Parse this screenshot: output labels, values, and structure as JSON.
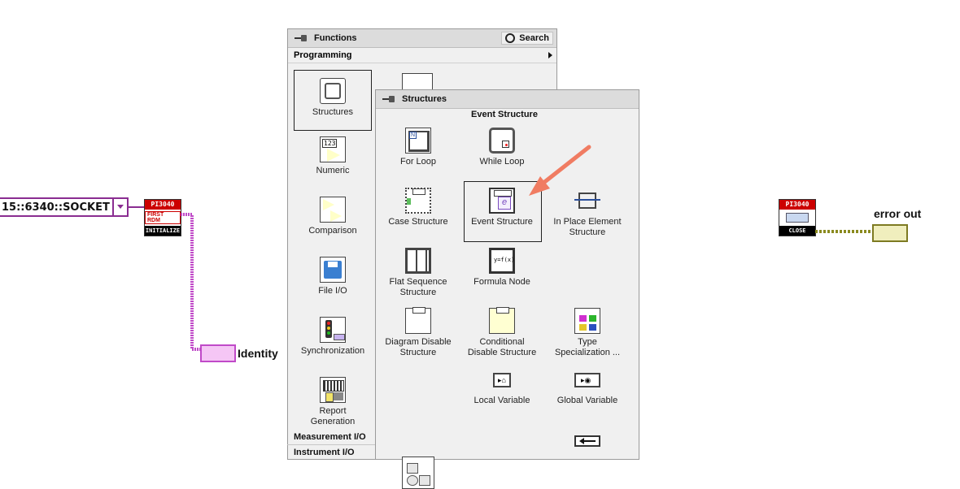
{
  "diagram": {
    "resource_text": "15::6340::SOCKET",
    "initialize_vi": {
      "header": "PI3040",
      "footer": "INITIALIZE",
      "badge": "FIRST RDM"
    },
    "close_vi": {
      "header": "PI3040",
      "footer": "CLOSE"
    },
    "identity_label": "Identity",
    "error_out_label": "error out"
  },
  "functions_palette": {
    "title": "Functions",
    "search_label": "Search",
    "category": "Programming",
    "items": [
      {
        "label": "Structures",
        "icon": "structures-icon"
      },
      {
        "label": "Numeric",
        "icon": "numeric-icon"
      },
      {
        "label": "Comparison",
        "icon": "comparison-icon"
      },
      {
        "label": "File I/O",
        "icon": "file-io-icon"
      },
      {
        "label": "Synchronization",
        "icon": "synchronization-icon"
      },
      {
        "label": "Report Generation",
        "icon": "report-generation-icon"
      }
    ],
    "sections": [
      "Measurement I/O",
      "Instrument I/O"
    ]
  },
  "structures_palette": {
    "title": "Structures",
    "hover_title": "Event Structure",
    "items": [
      {
        "label": "For Loop",
        "icon": "for-loop-icon"
      },
      {
        "label": "While Loop",
        "icon": "while-loop-icon"
      },
      {
        "label": "Case Structure",
        "icon": "case-structure-icon"
      },
      {
        "label": "Event Structure",
        "icon": "event-structure-icon"
      },
      {
        "label": "In Place Element Structure",
        "icon": "in-place-element-icon"
      },
      {
        "label": "Flat Sequence Structure",
        "icon": "flat-sequence-icon"
      },
      {
        "label": "Formula Node",
        "icon": "formula-node-icon"
      },
      {
        "label": "Diagram Disable Structure",
        "icon": "diagram-disable-icon"
      },
      {
        "label": "Conditional Disable Structure",
        "icon": "conditional-disable-icon"
      },
      {
        "label": "Type Specialization ...",
        "icon": "type-specialization-icon"
      },
      {
        "label": "Local Variable",
        "icon": "local-variable-icon"
      },
      {
        "label": "Global Variable",
        "icon": "global-variable-icon"
      }
    ]
  },
  "colors": {
    "arrow": "#f07c62",
    "class_wire": "#c04ac8",
    "error_wire": "#8a8a1f",
    "vi_header": "#cc0000"
  }
}
